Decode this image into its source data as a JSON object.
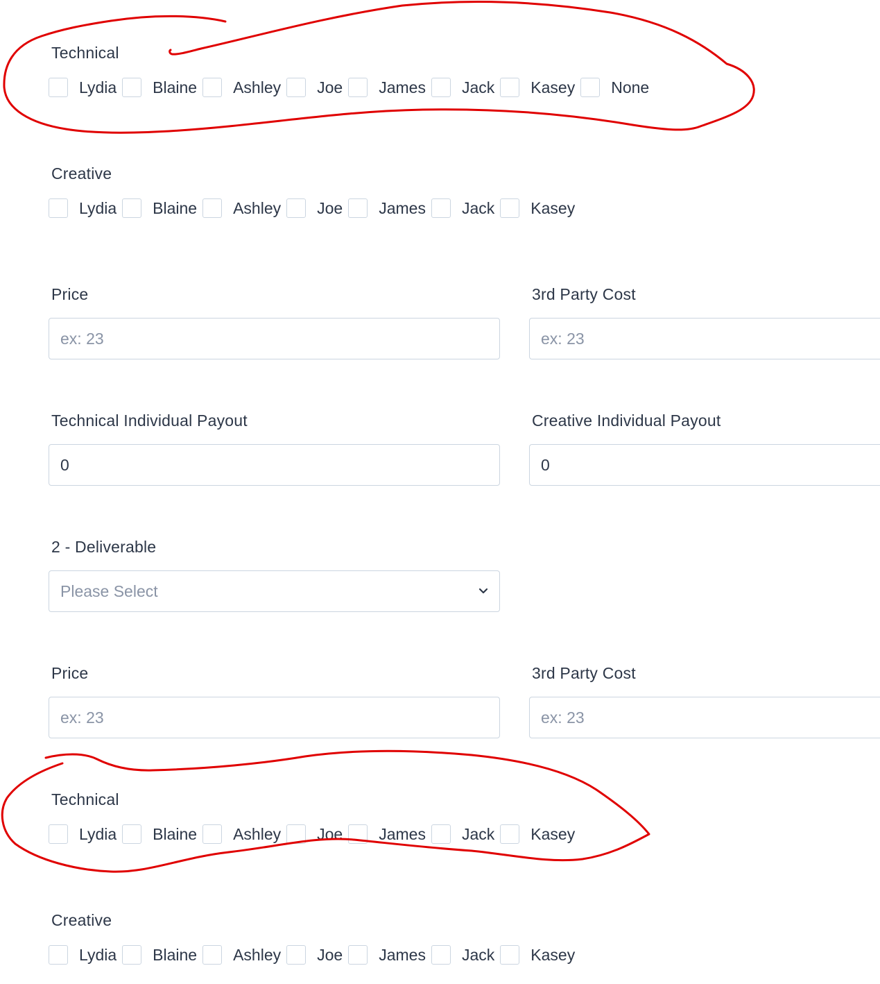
{
  "people_options_with_none": [
    "Lydia",
    "Blaine",
    "Ashley",
    "Joe",
    "James",
    "Jack",
    "Kasey",
    "None"
  ],
  "people_options": [
    "Lydia",
    "Blaine",
    "Ashley",
    "Joe",
    "James",
    "Jack",
    "Kasey"
  ],
  "section1": {
    "technical_label": "Technical",
    "creative_label": "Creative",
    "price_label": "Price",
    "price_placeholder": "ex: 23",
    "third_party_label": "3rd Party Cost",
    "third_party_placeholder": "ex: 23",
    "tech_payout_label": "Technical Individual Payout",
    "tech_payout_value": "0",
    "creative_payout_label": "Creative Individual Payout",
    "creative_payout_value": "0"
  },
  "deliverable2": {
    "label": "2 - Deliverable",
    "select_placeholder": "Please Select",
    "price_label": "Price",
    "price_placeholder": "ex: 23",
    "third_party_label": "3rd Party Cost",
    "third_party_placeholder": "ex: 23",
    "technical_label": "Technical",
    "creative_label": "Creative"
  },
  "colors": {
    "annotation": "#e00000",
    "border": "#cbd5e0",
    "text": "#2d3748",
    "placeholder": "#8a94a6"
  }
}
